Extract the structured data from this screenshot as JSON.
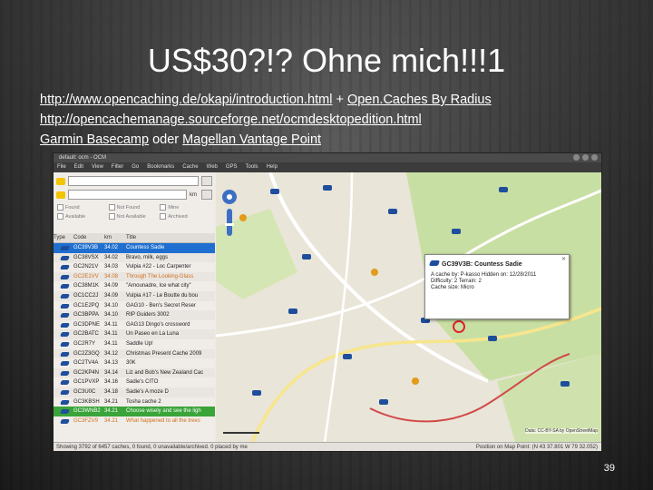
{
  "slide": {
    "title": "US$30?!? Ohne mich!!!1",
    "links": [
      {
        "text": "http://www.opencaching.de/okapi/introduction.html",
        "type": "link"
      },
      {
        "text": " + ",
        "type": "plain"
      },
      {
        "text": "Open.Caches By Radius",
        "type": "link"
      }
    ],
    "link_line2": "http://opencachemanage.sourceforge.net/ocmdesktopedition.html",
    "line3_link1": "Garmin Basecamp",
    "line3_sep": " oder ",
    "line3_link2": "Magellan Vantage Point",
    "page_number": "39"
  },
  "app": {
    "window_title": "default: ocm - OCM",
    "menu": [
      "File",
      "Edit",
      "View",
      "Filter",
      "Go",
      "Bookmarks",
      "Cache",
      "Web",
      "GPS",
      "Tools",
      "Help"
    ],
    "search_unit": "km",
    "filters": [
      "Found",
      "Not Found",
      "Mine",
      "Available",
      "Not Available",
      "Archived"
    ],
    "columns": [
      "Type",
      "Code",
      "km",
      "Title"
    ],
    "rows": [
      {
        "code": "GC39V3B",
        "km": "34.02",
        "title": "Countess Sadie",
        "state": "sel"
      },
      {
        "code": "GC38VSX",
        "km": "34.02",
        "title": "Bravo, milk, eggs",
        "state": ""
      },
      {
        "code": "GC2N21V",
        "km": "34.03",
        "title": "Vulpia #22 - Loc Carpenter",
        "state": ""
      },
      {
        "code": "GC2E1VV",
        "km": "34.08",
        "title": "Through The Looking-Glass",
        "state": "warn"
      },
      {
        "code": "GC38M1K",
        "km": "34.09",
        "title": "\"Amounadre, Ice what city\"",
        "state": ""
      },
      {
        "code": "GC1CC2J",
        "km": "34.09",
        "title": "Vulpia #17 - Le Boutte du bou",
        "state": ""
      },
      {
        "code": "GC1E2PQ",
        "km": "34.10",
        "title": "GAG10 - Ben's Secret Reser",
        "state": ""
      },
      {
        "code": "GC3BPPA",
        "km": "34.10",
        "title": "RIP Guiders 3002",
        "state": ""
      },
      {
        "code": "GC3DPNE",
        "km": "34.11",
        "title": "GAG13 Dingo's crossword",
        "state": ""
      },
      {
        "code": "GC2BATC",
        "km": "34.11",
        "title": "Un Paseo en La Luna",
        "state": ""
      },
      {
        "code": "GC2R7Y",
        "km": "34.11",
        "title": "Saddle Up!",
        "state": ""
      },
      {
        "code": "GC2Z3GQ",
        "km": "34.12",
        "title": "Christmas Present Cache 2009",
        "state": ""
      },
      {
        "code": "GC2TV4A",
        "km": "34.13",
        "title": "30K",
        "state": ""
      },
      {
        "code": "GC2KP4N",
        "km": "34.14",
        "title": "Liz and Bob's New Zealand Cac",
        "state": ""
      },
      {
        "code": "GC1PVXP",
        "km": "34.16",
        "title": "Sadie's CITO",
        "state": ""
      },
      {
        "code": "GC3U0C",
        "km": "34.18",
        "title": "Sadie's A moze D",
        "state": ""
      },
      {
        "code": "GC3KBSH",
        "km": "34.21",
        "title": "Tosha cache 2",
        "state": ""
      },
      {
        "code": "GC3WNB2",
        "km": "34.21",
        "title": "Choose wisely and see the ligh",
        "state": "sel2"
      },
      {
        "code": "GC3FZV9",
        "km": "34.21",
        "title": "What happened to all the trees",
        "state": "warn"
      }
    ],
    "status_text": "Showing 3792 of 6457 caches, 0 found, 0 unavailable/archived. 0 placed by me",
    "coords_text": "Position on Map Point: (N 43 37.801  W 79 32.052)",
    "popup": {
      "title": "GC39V3B: Countess Sadie",
      "line1": "A cache by: P-kasso  Hidden on: 12/28/2011",
      "line2": "Difficulty: 2  Terrain: 2",
      "line3": "Cache size: Micro"
    },
    "map_attribution": "Data: CC-BY-SA by OpenStreetMap",
    "icon_colors": {
      "traditional": "#1e4e9c",
      "multi": "#e39b1a",
      "selection": "#1f6fd0"
    }
  }
}
